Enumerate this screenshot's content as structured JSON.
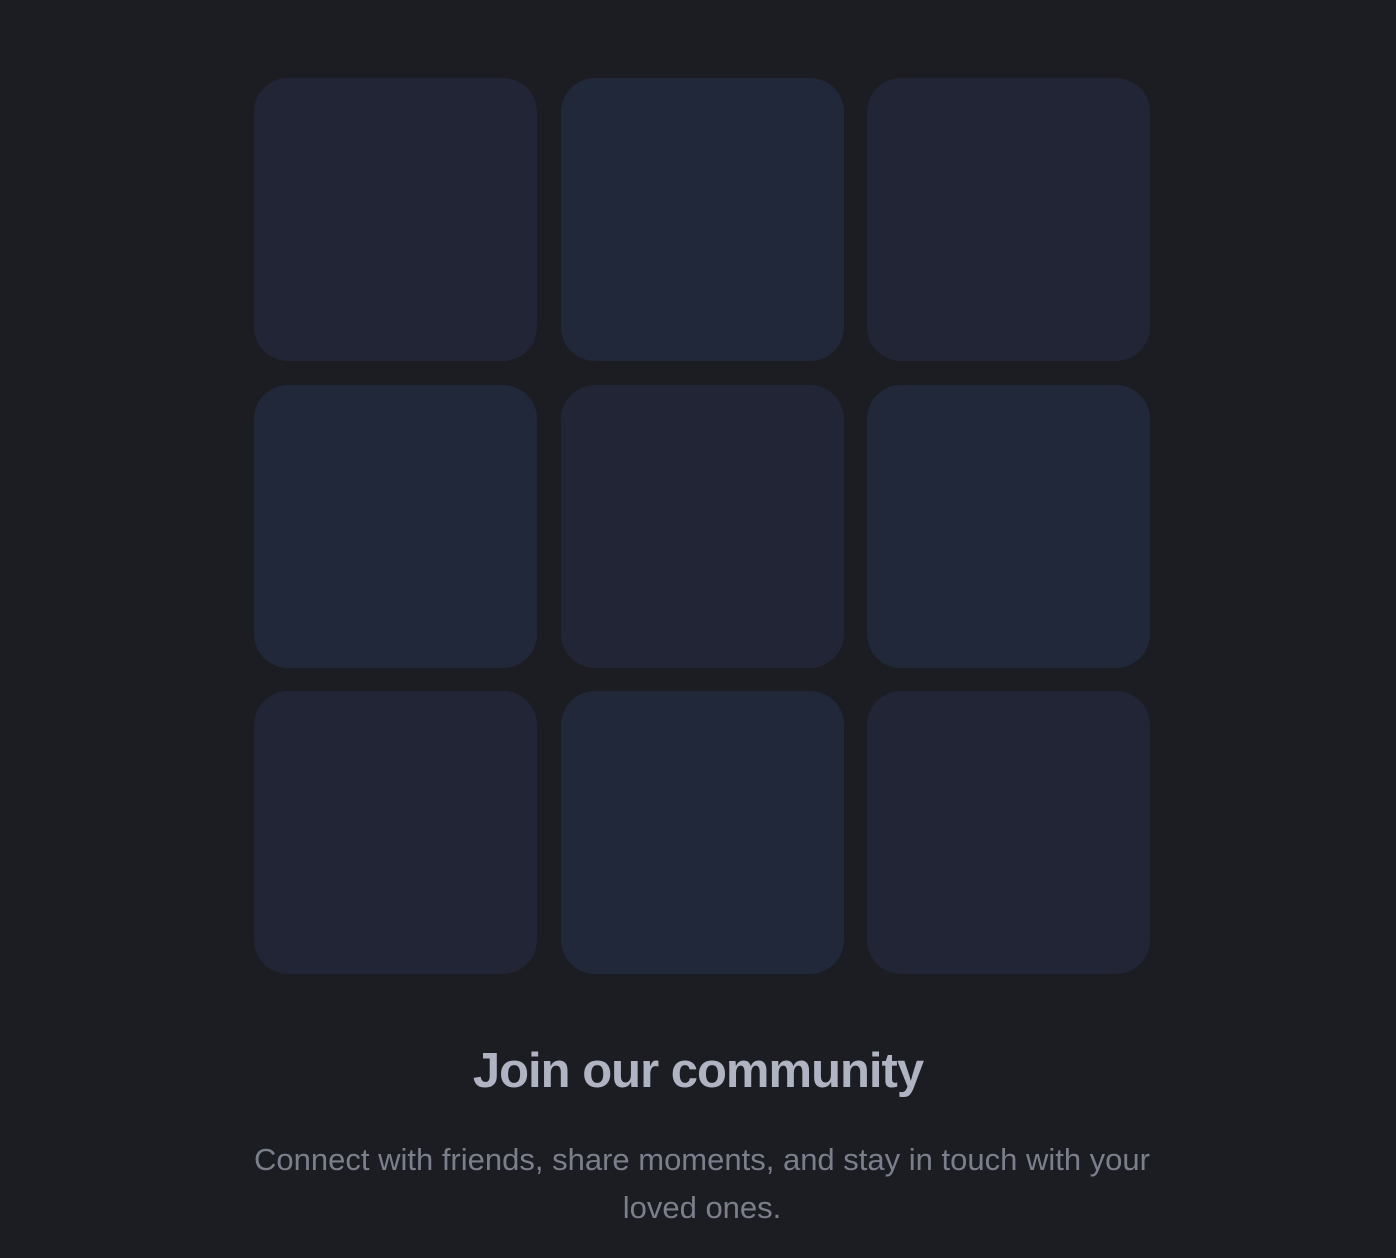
{
  "colors": {
    "background": "#1b1d22",
    "tile_tone_a": "#222535",
    "tile_tone_b": "#212839",
    "headline": "#b0b3c2",
    "subtext": "#7b7f8c"
  },
  "tiles": [
    {
      "tone": "a"
    },
    {
      "tone": "b"
    },
    {
      "tone": "a"
    },
    {
      "tone": "b"
    },
    {
      "tone": "a"
    },
    {
      "tone": "b"
    },
    {
      "tone": "a"
    },
    {
      "tone": "b"
    },
    {
      "tone": "a"
    }
  ],
  "community": {
    "title": "Join our community",
    "description": "Connect with friends, share moments, and stay in touch with your loved ones."
  }
}
